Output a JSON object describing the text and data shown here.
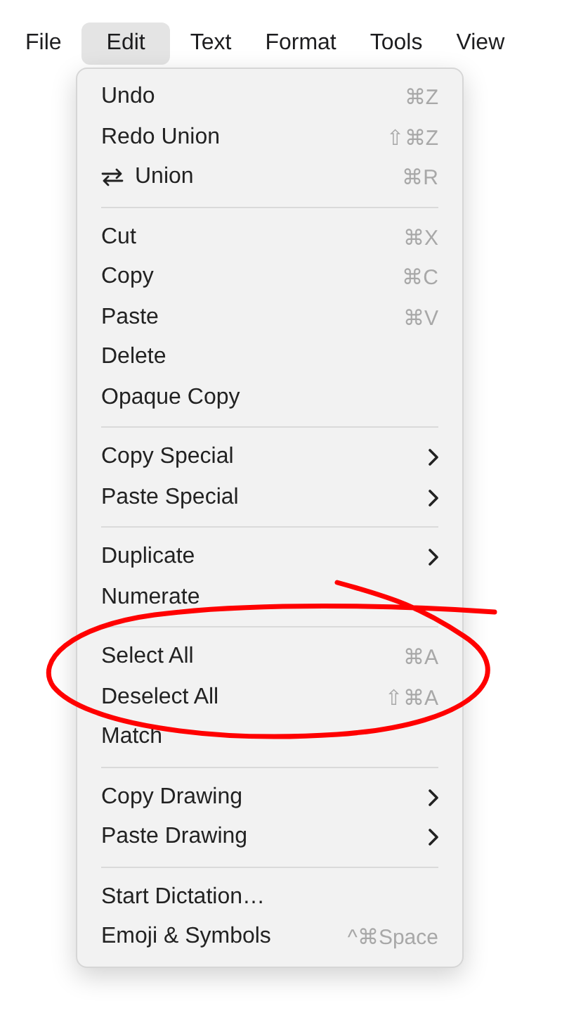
{
  "menubar": [
    {
      "label": "File",
      "selected": false
    },
    {
      "label": "Edit",
      "selected": true
    },
    {
      "label": "Text",
      "selected": false
    },
    {
      "label": "Format",
      "selected": false
    },
    {
      "label": "Tools",
      "selected": false
    },
    {
      "label": "View",
      "selected": false
    }
  ],
  "menu": {
    "groups": [
      [
        {
          "label": "Undo",
          "shortcut": "⌘Z",
          "submenu": false
        },
        {
          "label": "Redo Union",
          "shortcut": "⇧⌘Z",
          "submenu": false
        },
        {
          "label": "Union",
          "shortcut": "⌘R",
          "submenu": false,
          "has_icon": true
        }
      ],
      [
        {
          "label": "Cut",
          "shortcut": "⌘X",
          "submenu": false
        },
        {
          "label": "Copy",
          "shortcut": "⌘C",
          "submenu": false
        },
        {
          "label": "Paste",
          "shortcut": "⌘V",
          "submenu": false
        },
        {
          "label": "Delete",
          "submenu": false
        },
        {
          "label": "Opaque Copy",
          "submenu": false
        }
      ],
      [
        {
          "label": "Copy Special",
          "submenu": true
        },
        {
          "label": "Paste Special",
          "submenu": true
        }
      ],
      [
        {
          "label": "Duplicate",
          "submenu": true
        },
        {
          "label": "Numerate",
          "submenu": false
        }
      ],
      [
        {
          "label": "Select All",
          "shortcut": "⌘A",
          "submenu": false
        },
        {
          "label": "Deselect All",
          "shortcut": "⇧⌘A",
          "submenu": false
        },
        {
          "label": "Match",
          "submenu": false
        }
      ],
      [
        {
          "label": "Copy Drawing",
          "submenu": true
        },
        {
          "label": "Paste Drawing",
          "submenu": true
        }
      ],
      [
        {
          "label": "Start Dictation…",
          "submenu": false
        },
        {
          "label": "Emoji & Symbols",
          "shortcut": "^⌘Space",
          "submenu": false
        }
      ]
    ]
  }
}
